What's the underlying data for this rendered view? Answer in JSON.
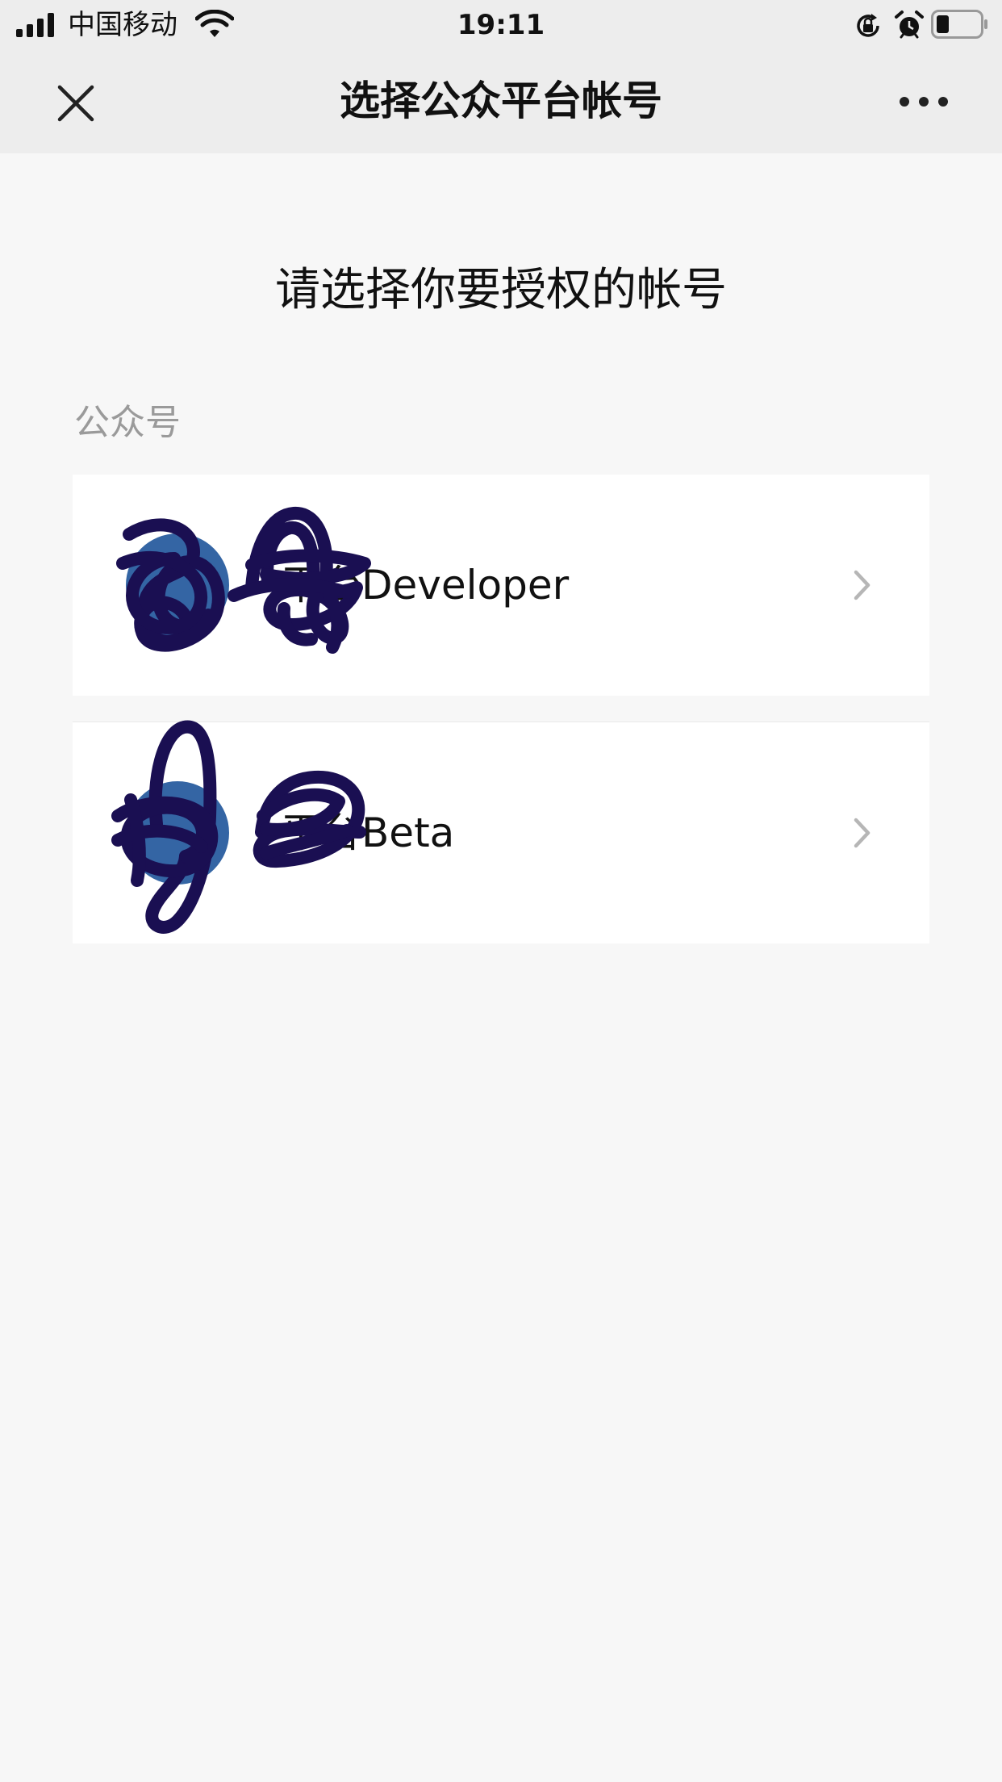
{
  "status_bar": {
    "carrier": "中国移动",
    "time": "19:11",
    "icons": [
      "signal-icon",
      "wifi-icon",
      "rotation-lock-icon",
      "alarm-icon",
      "battery-icon"
    ]
  },
  "nav": {
    "title": "选择公众平台帐号",
    "close_icon": "close-icon",
    "more_icon": "more-icon"
  },
  "prompt": "请选择你要授权的帐号",
  "section_label": "公众号",
  "accounts": [
    {
      "name": "平台Developer",
      "avatar_color": "#3465a4"
    },
    {
      "name": "平台Beta",
      "avatar_color": "#3465a4"
    }
  ],
  "colors": {
    "background": "#f7f7f7",
    "bar_background": "#ededed",
    "row_background": "#ffffff",
    "secondary_text": "#9a9a9a",
    "redaction_ink": "#1a0f52"
  }
}
